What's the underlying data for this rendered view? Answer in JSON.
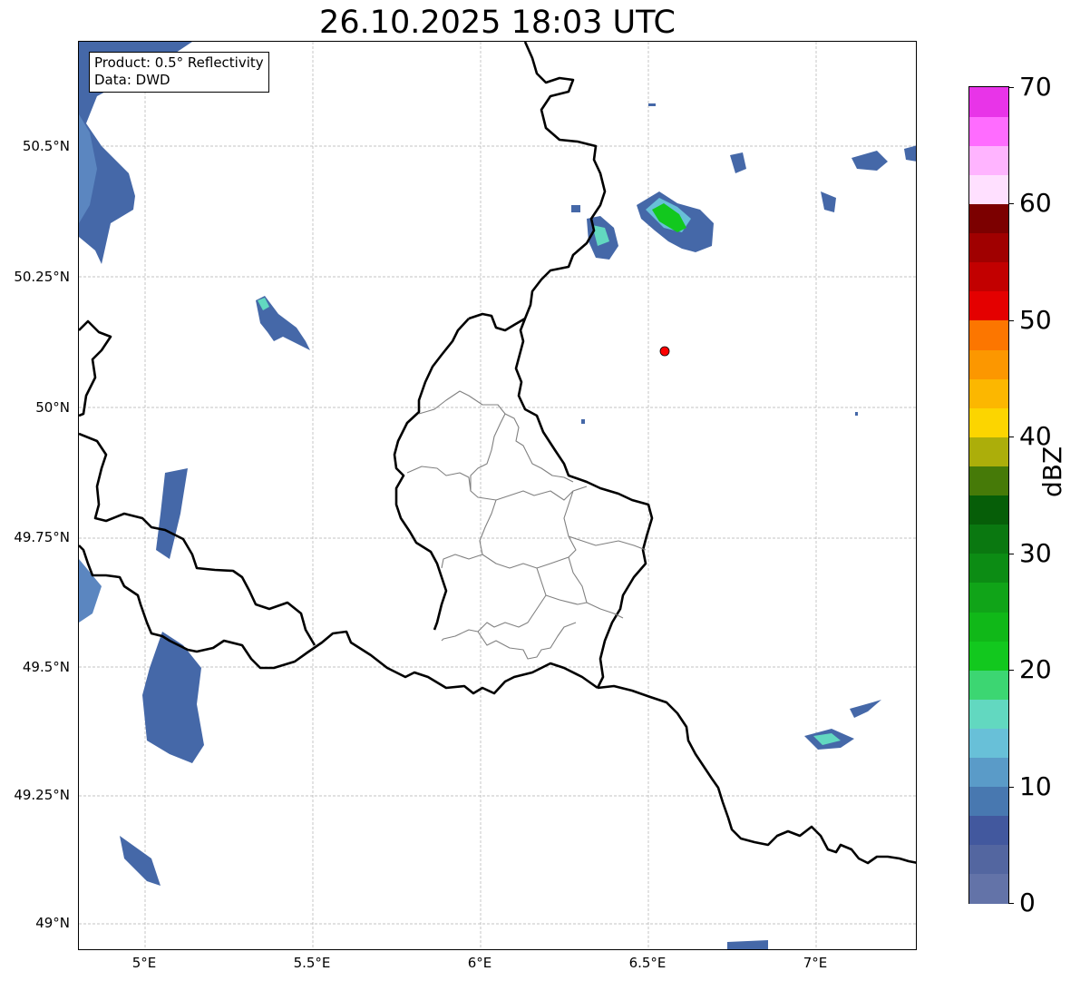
{
  "title": "26.10.2025 18:03 UTC",
  "info": {
    "product": "Product: 0.5° Reflectivity",
    "source": "Data: DWD"
  },
  "axes": {
    "lat_ticks": [
      "50.5°N",
      "50.25°N",
      "50°N",
      "49.75°N",
      "49.5°N",
      "49.25°N",
      "49°N"
    ],
    "lon_ticks": [
      "5°E",
      "5.5°E",
      "6°E",
      "6.5°E",
      "7°E"
    ]
  },
  "colorbar": {
    "unit": "dBZ",
    "labels": [
      "70",
      "60",
      "50",
      "40",
      "30",
      "20",
      "10",
      "0"
    ],
    "range": [
      0,
      70
    ],
    "colors": [
      "#6373a8",
      "#5366a0",
      "#42589e",
      "#4878b0",
      "#5a9bc8",
      "#68c0d8",
      "#62d8c0",
      "#3cd672",
      "#12c81e",
      "#10b818",
      "#10a418",
      "#0c8c14",
      "#0a7810",
      "#065e08",
      "#467a08",
      "#acae0a",
      "#fcd500",
      "#fcb700",
      "#fc9700",
      "#fc7600",
      "#e40000",
      "#c20000",
      "#a00000",
      "#7c0000",
      "#ffe0ff",
      "#ffb4ff",
      "#ff6cff",
      "#e834e8"
    ]
  },
  "colors": {
    "border": "#000000",
    "district": "#808080",
    "radar_site": "#ff0000",
    "echo_base": "#4568a8"
  }
}
